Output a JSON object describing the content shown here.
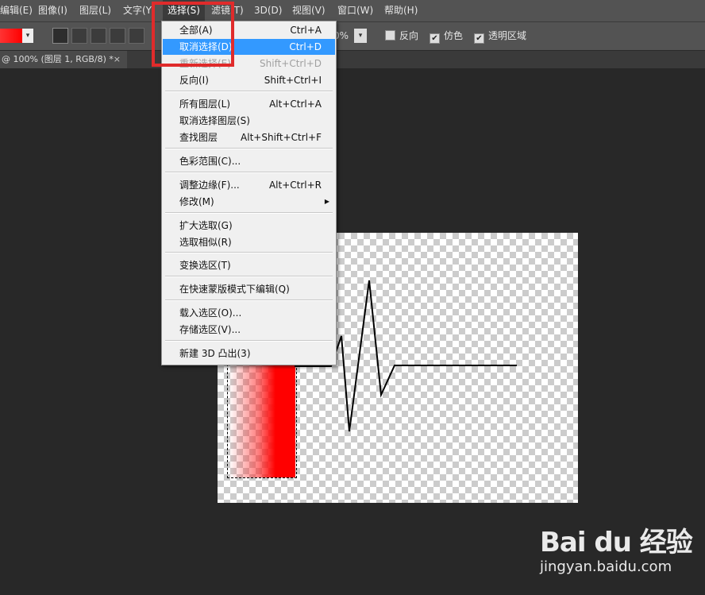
{
  "menubar": {
    "items": [
      {
        "label": "编辑(E)"
      },
      {
        "label": "图像(I)"
      },
      {
        "label": "图层(L)"
      },
      {
        "label": "文字(Y)"
      },
      {
        "label": "选择(S)"
      },
      {
        "label": "滤镜(T)"
      },
      {
        "label": "3D(D)"
      },
      {
        "label": "视图(V)"
      },
      {
        "label": "窗口(W)"
      },
      {
        "label": "帮助(H)"
      }
    ]
  },
  "options": {
    "opacity_value": "0%",
    "reverse_label": "反向",
    "reverse_checked": "",
    "dither_label": "仿色",
    "dither_checked": "✔",
    "transparency_label": "透明区域",
    "transparency_checked": "✔"
  },
  "document": {
    "tab_label": "@ 100% (图层 1, RGB/8) *",
    "close_glyph": "×"
  },
  "select_menu": {
    "items": [
      {
        "label": "全部(A)",
        "shortcut": "Ctrl+A"
      },
      {
        "label": "取消选择(D)",
        "shortcut": "Ctrl+D"
      },
      {
        "label": "重新选择(E)",
        "shortcut": "Shift+Ctrl+D"
      },
      {
        "label": "反向(I)",
        "shortcut": "Shift+Ctrl+I"
      },
      {
        "label": "所有图层(L)",
        "shortcut": "Alt+Ctrl+A"
      },
      {
        "label": "取消选择图层(S)",
        "shortcut": ""
      },
      {
        "label": "查找图层",
        "shortcut": "Alt+Shift+Ctrl+F"
      },
      {
        "label": "色彩范围(C)...",
        "shortcut": ""
      },
      {
        "label": "调整边缘(F)...",
        "shortcut": "Alt+Ctrl+R"
      },
      {
        "label": "修改(M)",
        "shortcut": ""
      },
      {
        "label": "扩大选取(G)",
        "shortcut": ""
      },
      {
        "label": "选取相似(R)",
        "shortcut": ""
      },
      {
        "label": "变换选区(T)",
        "shortcut": ""
      },
      {
        "label": "在快速蒙版模式下编辑(Q)",
        "shortcut": ""
      },
      {
        "label": "载入选区(O)...",
        "shortcut": ""
      },
      {
        "label": "存储选区(V)...",
        "shortcut": ""
      },
      {
        "label": "新建 3D 凸出(3)",
        "shortcut": ""
      }
    ],
    "submenu_arrow": "▶",
    "highlight_color": "#3399ff"
  },
  "watermark": {
    "logo": "Bai du 经验",
    "url": "jingyan.baidu.com"
  },
  "colors": {
    "annotation_red": "#e02b2b",
    "layer_red": "#ff0000"
  }
}
